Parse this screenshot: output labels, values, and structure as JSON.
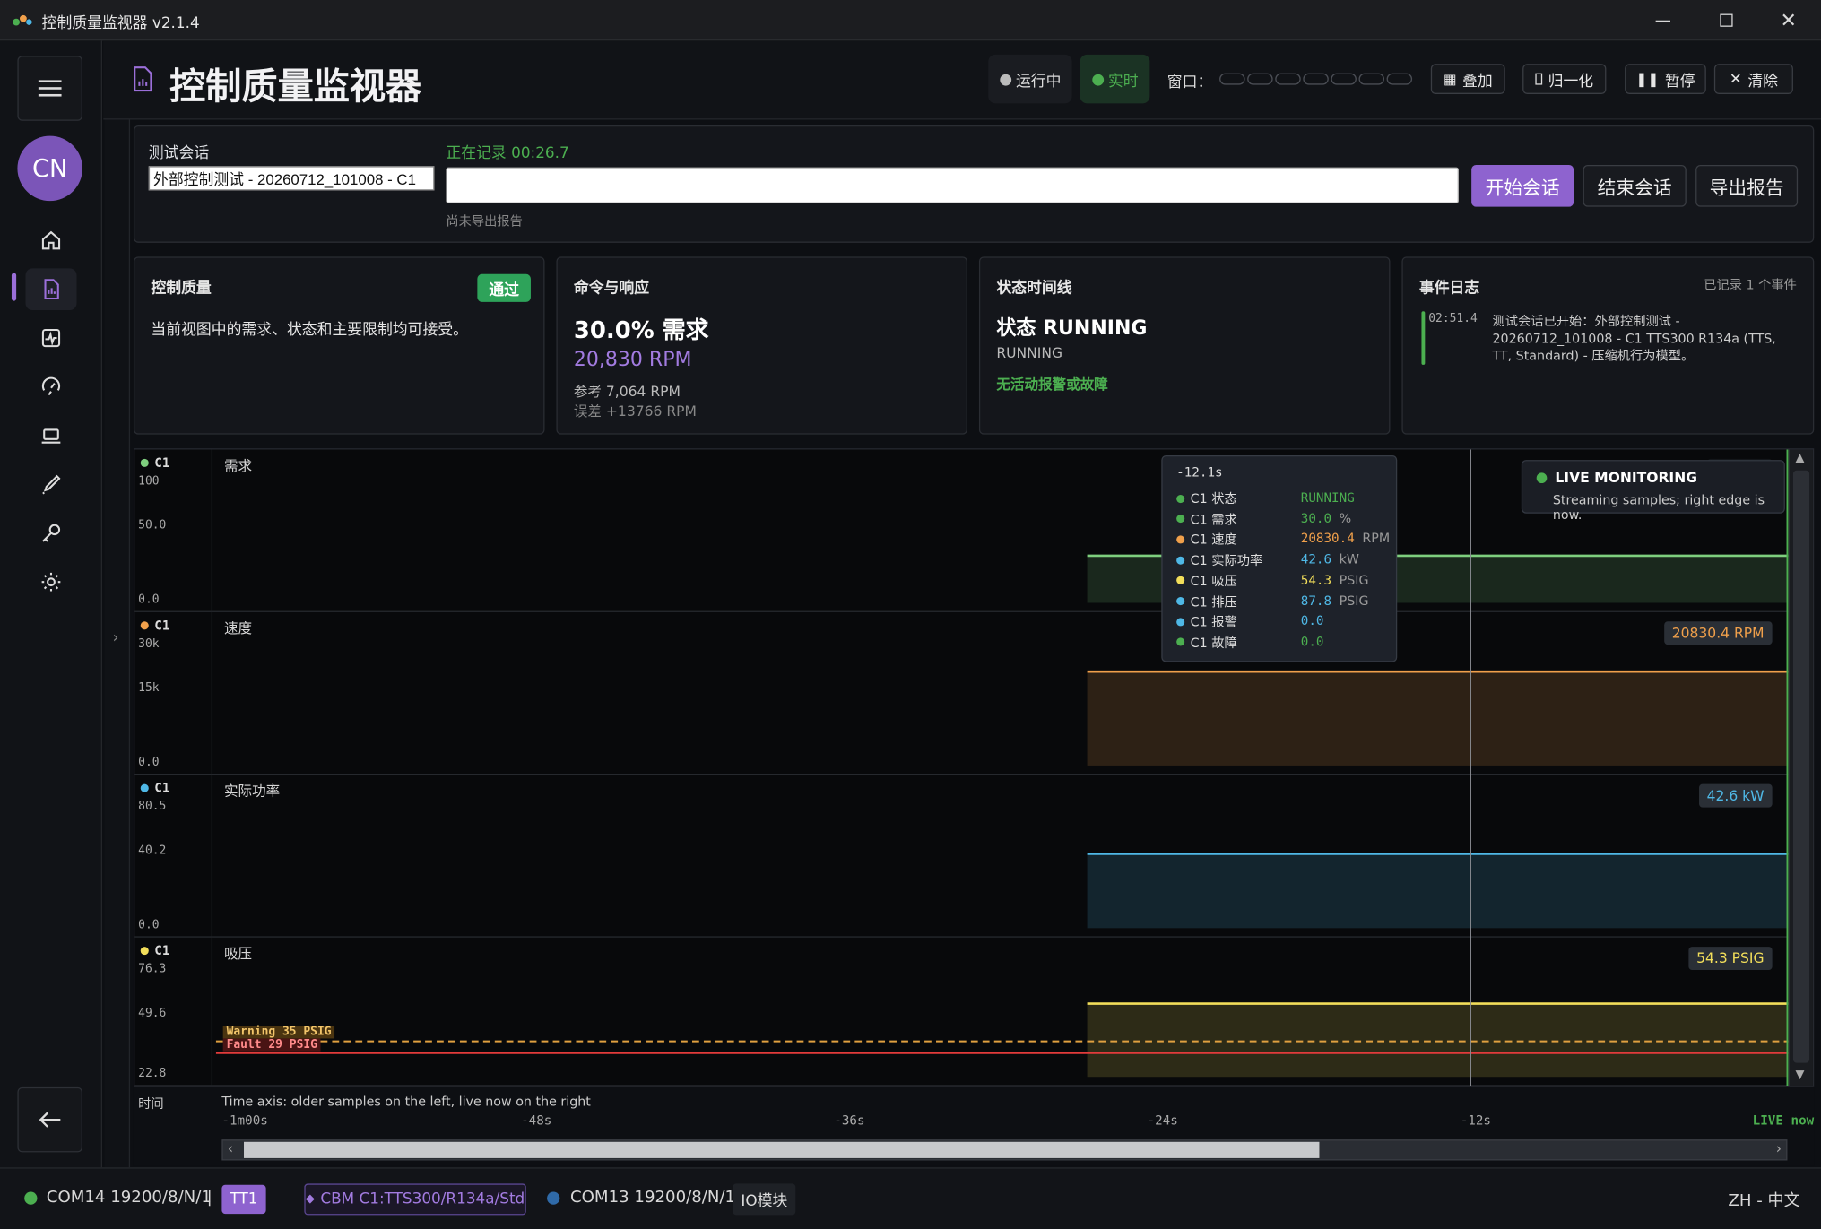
{
  "window": {
    "title": "控制质量监视器 v2.1.4"
  },
  "sidebar": {
    "avatar": "CN"
  },
  "header": {
    "title": "控制质量监视器",
    "status_running": "运行中",
    "status_live": "实时",
    "window_label": "窗口：",
    "btn_overlay": "叠加",
    "btn_normalize": "归一化",
    "btn_pause": "暂停",
    "btn_clear": "清除"
  },
  "session": {
    "label": "测试会话",
    "name_value": "外部控制测试 - 20260712_101008 - C1",
    "recording": "正在记录 00:26.7",
    "notes_value": "",
    "export_status": "尚未导出报告",
    "btn_start": "开始会话",
    "btn_end": "结束会话",
    "btn_export": "导出报告"
  },
  "cards": {
    "quality": {
      "title": "控制质量",
      "badge": "通过",
      "text": "当前视图中的需求、状态和主要限制均可接受。"
    },
    "command": {
      "title": "命令与响应",
      "demand": "30.0% 需求",
      "rpm": "20,830 RPM",
      "ref": "参考 7,064 RPM",
      "err": "误差 +13766 RPM"
    },
    "state": {
      "title": "状态时间线",
      "state_big": "状态 RUNNING",
      "state_small": "RUNNING",
      "alarm": "无活动报警或故障"
    },
    "events": {
      "title": "事件日志",
      "count": "已记录 1 个事件",
      "time": "02:51.4",
      "text": "测试会话已开始：外部控制测试 - 20260712_101008 - C1 TTS300 R134a (TTS, TT, Standard) - 压缩机行为模型。"
    }
  },
  "chart_data": {
    "type": "line",
    "x_unit": "s",
    "x_range": [
      -60,
      0
    ],
    "series_start": -26.7,
    "cursor_x": -12.1,
    "lanes": [
      {
        "tag": "C1",
        "name": "需求",
        "ticks": [
          "100",
          "50.0",
          "0.0"
        ],
        "ylim": [
          0,
          100
        ],
        "value": 30.0,
        "unit": "%",
        "badge": "30.0 %",
        "color": "#7fcf7f"
      },
      {
        "tag": "C1",
        "name": "速度",
        "ticks": [
          "30k",
          "15k",
          "0.0"
        ],
        "ylim": [
          0,
          30000
        ],
        "value": 20830.4,
        "unit": "RPM",
        "badge": "20830.4 RPM",
        "color": "#f0a04b"
      },
      {
        "tag": "C1",
        "name": "实际功率",
        "ticks": [
          "80.5",
          "40.2",
          "0.0"
        ],
        "ylim": [
          0,
          80.5
        ],
        "value": 42.6,
        "unit": "kW",
        "badge": "42.6 kW",
        "color": "#4fb8e6"
      },
      {
        "tag": "C1",
        "name": "吸压",
        "ticks": [
          "76.3",
          "49.6",
          "22.8"
        ],
        "ylim": [
          22.8,
          76.3
        ],
        "value": 54.3,
        "unit": "PSIG",
        "badge": "54.3 PSIG",
        "color": "#f2de5a",
        "limits": [
          {
            "label": "Warning 35 PSIG",
            "value": 35
          },
          {
            "label": "Fault 29 PSIG",
            "value": 29
          }
        ]
      }
    ],
    "x_ticks": [
      "-1m00s",
      "-48s",
      "-36s",
      "-24s",
      "-12s",
      "LIVE now"
    ],
    "axis_label": "时间",
    "axis_hint": "Time axis: older samples on the left, live now on the right"
  },
  "tooltip": {
    "time": "-12.1s",
    "rows": [
      {
        "name": "C1 状态",
        "value": "RUNNING",
        "unit": "",
        "color": "#4caf50"
      },
      {
        "name": "C1 需求",
        "value": "30.0",
        "unit": "%",
        "color": "#4caf50"
      },
      {
        "name": "C1 速度",
        "value": "20830.4",
        "unit": "RPM",
        "color": "#f0a04b"
      },
      {
        "name": "C1 实际功率",
        "value": "42.6",
        "unit": "kW",
        "color": "#4fb8e6"
      },
      {
        "name": "C1 吸压",
        "value": "54.3",
        "unit": "PSIG",
        "color": "#f2de5a"
      },
      {
        "name": "C1 排压",
        "value": "87.8",
        "unit": "PSIG",
        "color": "#4fb8e6"
      },
      {
        "name": "C1 报警",
        "value": "0.0",
        "unit": "",
        "color": "#4fb8e6"
      },
      {
        "name": "C1 故障",
        "value": "0.0",
        "unit": "",
        "color": "#4caf50"
      }
    ]
  },
  "live": {
    "title": "LIVE MONITORING",
    "sub": "Streaming samples; right edge is now."
  },
  "statusbar": {
    "port1": "COM14 19200/8/N/1",
    "sep": "|",
    "tt": "TT1",
    "cbm": "CBM C1:TTS300/R134a/Std",
    "port2": "COM13 19200/8/N/1",
    "io": "IO模块",
    "lang": "ZH - 中文"
  }
}
